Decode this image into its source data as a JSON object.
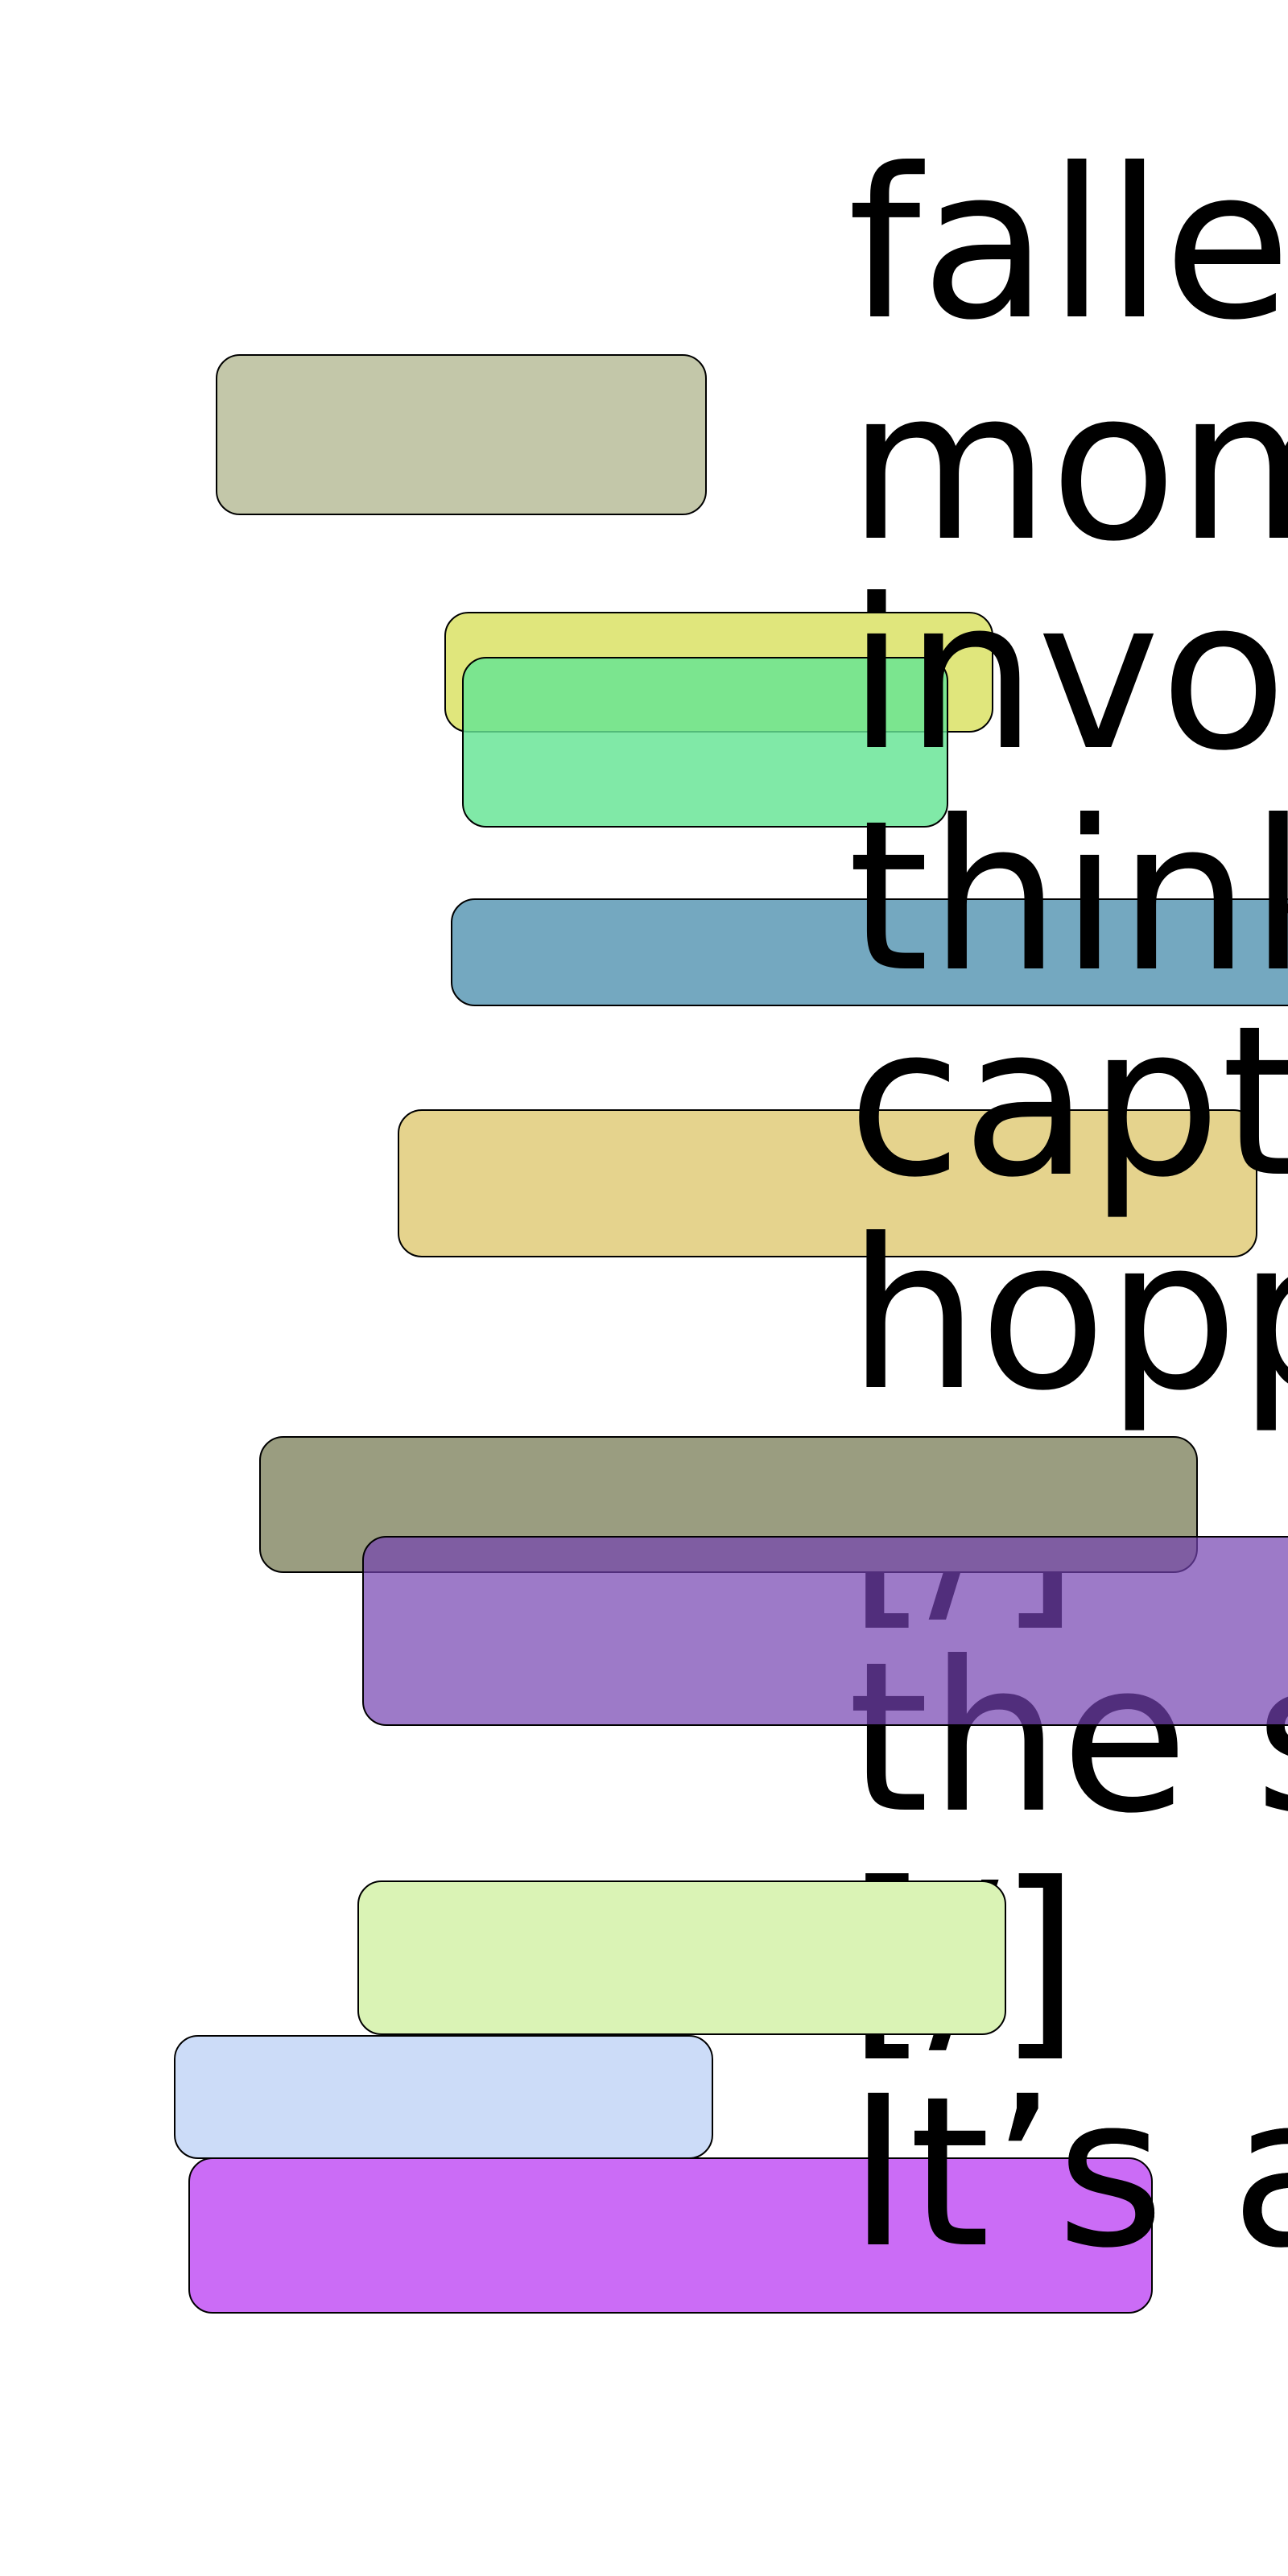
{
  "blocks": [
    {
      "name": "sage-block",
      "color": "#c3c7a9"
    },
    {
      "name": "yellow-block",
      "color": "#e0e67c"
    },
    {
      "name": "mint-block",
      "color": "rgba(100,228,148,0.82)"
    },
    {
      "name": "steel-blue-block",
      "color": "#74a8c0"
    },
    {
      "name": "sand-block",
      "color": "#e5d38d"
    },
    {
      "name": "olive-block",
      "color": "#9a9d80"
    },
    {
      "name": "purple-block",
      "color": "rgba(115,66,176,0.70)"
    },
    {
      "name": "lime-block",
      "color": "#daf3b5"
    },
    {
      "name": "periwinkle-block",
      "color": "#ccdcf8"
    },
    {
      "name": "violet-block",
      "color": "#cb6cf6"
    }
  ],
  "words": [
    "fallen",
    "mom",
    "involved",
    "think",
    "captain",
    "hopping",
    "[/]",
    "the s",
    "[/]",
    "It’s a"
  ]
}
